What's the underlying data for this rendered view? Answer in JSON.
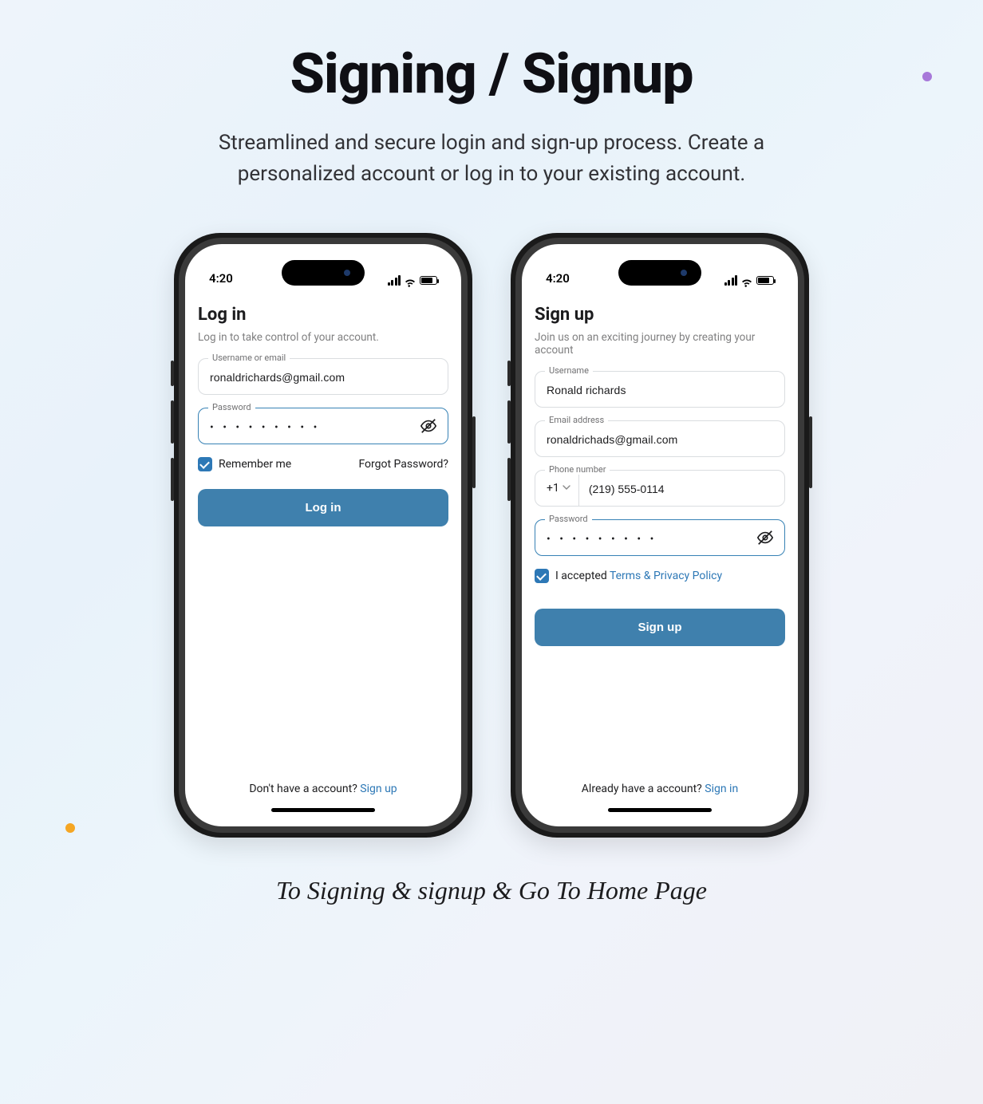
{
  "hero": {
    "title": "Signing / Signup",
    "subtitle": "Streamlined and secure login and sign-up process. Create a personalized account or log in to your existing account."
  },
  "statusBar": {
    "time": "4:20"
  },
  "login": {
    "title": "Log in",
    "subtitle": "Log in to take control of your account.",
    "field1Label": "Username or email",
    "field1Value": "ronaldrichards@gmail.com",
    "field2Label": "Password",
    "field2Value": "• • • • • • • • •",
    "rememberLabel": "Remember me",
    "forgotLabel": "Forgot Password?",
    "buttonLabel": "Log in",
    "footerPrefix": "Don't have a account? ",
    "footerLink": "Sign up"
  },
  "signup": {
    "title": "Sign up",
    "subtitle": "Join us on an exciting journey by creating your account",
    "usernameLabel": "Username",
    "usernameValue": "Ronald richards",
    "emailLabel": "Email address",
    "emailValue": "ronaldrichads@gmail.com",
    "phoneLabel": "Phone number",
    "countryCode": "+1",
    "phoneValue": "(219) 555-0114",
    "passwordLabel": "Password",
    "passwordValue": "• • • • • • • • •",
    "acceptedPrefix": "I accepted ",
    "acceptedLink": "Terms & Privacy Policy",
    "buttonLabel": "Sign up",
    "footerPrefix": "Already have a account? ",
    "footerLink": "Sign in"
  },
  "caption": "To Signing & signup & Go To Home Page"
}
